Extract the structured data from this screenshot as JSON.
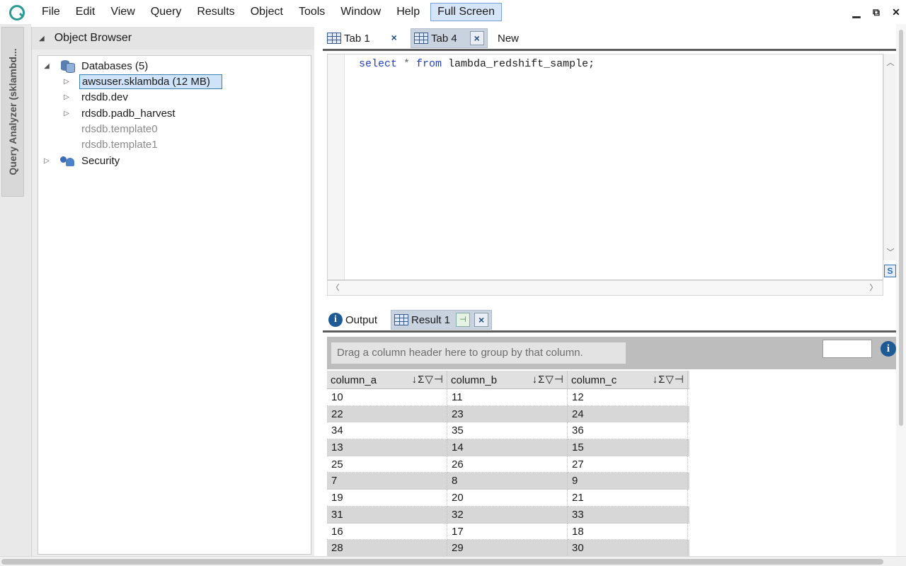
{
  "menu": {
    "items": [
      "File",
      "Edit",
      "View",
      "Query",
      "Results",
      "Object",
      "Tools",
      "Window",
      "Help"
    ],
    "fullscreen_label": "Full Screen"
  },
  "window_controls": {
    "minimize": "▁",
    "restore": "⧉",
    "close": "✕"
  },
  "side_tab": {
    "label": "Query Analyzer (sklambd..."
  },
  "object_browser": {
    "title": "Object Browser",
    "tree": {
      "databases_label": "Databases (5)",
      "databases": [
        "awsuser.sklambda (12 MB)",
        "rdsdb.dev",
        "rdsdb.padb_harvest",
        "rdsdb.template0",
        "rdsdb.template1"
      ],
      "security_label": "Security"
    }
  },
  "query_tabs": [
    {
      "label": "Tab 1"
    },
    {
      "label": "Tab 4"
    },
    {
      "label": "New"
    }
  ],
  "editor": {
    "sql_keyword_select": "select",
    "sql_star": " * ",
    "sql_keyword_from": "from",
    "sql_rest": " lambda_redshift_sample;"
  },
  "result_tabs": {
    "output_label": "Output",
    "result_label": "Result 1"
  },
  "group_panel": {
    "hint": "Drag a column header here to group by that column."
  },
  "grid": {
    "columns": [
      "column_a",
      "column_b",
      "column_c"
    ],
    "column_icons": "↓Σ▽⊣",
    "rows": [
      [
        "10",
        "11",
        "12"
      ],
      [
        "22",
        "23",
        "24"
      ],
      [
        "34",
        "35",
        "36"
      ],
      [
        "13",
        "14",
        "15"
      ],
      [
        "25",
        "26",
        "27"
      ],
      [
        "7",
        "8",
        "9"
      ],
      [
        "19",
        "20",
        "21"
      ],
      [
        "31",
        "32",
        "33"
      ],
      [
        "16",
        "17",
        "18"
      ],
      [
        "28",
        "29",
        "30"
      ]
    ]
  }
}
